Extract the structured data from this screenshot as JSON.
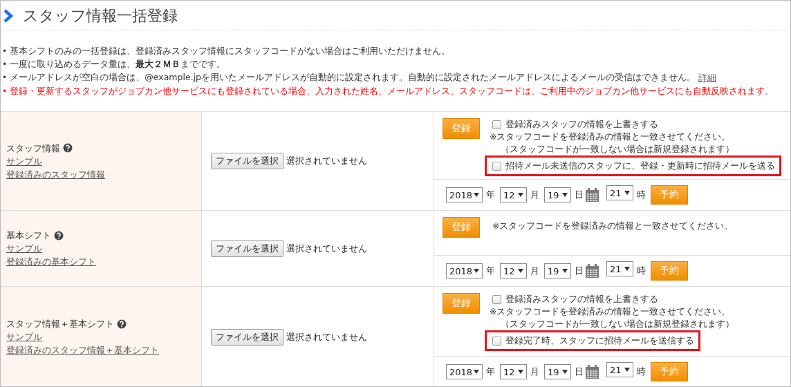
{
  "page": {
    "title": "スタッフ情報一括登録"
  },
  "notes": [
    {
      "kind": "plain",
      "text": "• 基本シフトのみの一括登録は、登録済みスタッフ情報にスタッフコードがない場合はご利用いただけません。"
    },
    {
      "kind": "plain",
      "text": "• 一度に取り込めるデータ量は、**最大２ＭＢ**までです。"
    },
    {
      "kind": "plain",
      "text": "• メールアドレスが空白の場合は、@example.jpを用いたメールアドレスが自動的に設定されます。自動的に設定されたメールアドレスによるメールの受信はできません。",
      "link": "詳細"
    },
    {
      "kind": "warning",
      "text": "• 登録・更新するスタッフがジョブカン他サービスにも登録されている場合、入力された姓名、メールアドレス、スタッフコードは、ご利用中のジョブカン他サービスにも自動反映されます。"
    }
  ],
  "sections": [
    {
      "label": "スタッフ情報",
      "help": true,
      "links": [
        "サンプル",
        "登録済みのスタッフ情報"
      ],
      "file_button": "ファイルを選択",
      "file_status": "選択されていません",
      "register_button": "登録",
      "options": [
        {
          "kind": "checkbox",
          "label": "登録済みスタッフの情報を上書きする",
          "checked": false,
          "highlighted": false
        },
        {
          "kind": "note",
          "text": "※スタッフコードを登録済みの情報と一致させてください。"
        },
        {
          "kind": "subnote",
          "text": "（スタッフコードが一致しない場合は新規登録されます）"
        },
        {
          "kind": "checkbox",
          "label": "招待メール未送信のスタッフに、登録・更新時に招待メールを送る",
          "checked": false,
          "highlighted": true
        }
      ],
      "schedule": {
        "year": "2018",
        "year_unit": "年",
        "month": "12",
        "month_unit": "月",
        "day": "19",
        "day_unit": "日",
        "hour": "21",
        "hour_unit": "時",
        "button": "予約"
      }
    },
    {
      "label": "基本シフト",
      "help": true,
      "links": [
        "サンプル",
        "登録済みの基本シフト"
      ],
      "file_button": "ファイルを選択",
      "file_status": "選択されていません",
      "register_button": "登録",
      "options": [
        {
          "kind": "inline-note",
          "text": "※スタッフコードを登録済みの情報と一致させてください。"
        }
      ],
      "schedule": {
        "year": "2018",
        "year_unit": "年",
        "month": "12",
        "month_unit": "月",
        "day": "19",
        "day_unit": "日",
        "hour": "21",
        "hour_unit": "時",
        "button": "予約"
      }
    },
    {
      "label": "スタッフ情報＋基本シフト",
      "help": true,
      "links": [
        "サンプル",
        "登録済みのスタッフ情報＋基本シフト"
      ],
      "file_button": "ファイルを選択",
      "file_status": "選択されていません",
      "register_button": "登録",
      "options": [
        {
          "kind": "checkbox",
          "label": "登録済みスタッフの情報を上書きする",
          "checked": false,
          "highlighted": false
        },
        {
          "kind": "note",
          "text": "※スタッフコードを登録済みの情報と一致させてください。"
        },
        {
          "kind": "subnote",
          "text": "（スタッフコードが一致しない場合は新規登録されます）"
        },
        {
          "kind": "checkbox",
          "label": "登録完了時、スタッフに招待メールを送信する",
          "checked": false,
          "highlighted": true
        }
      ],
      "schedule": {
        "year": "2018",
        "year_unit": "年",
        "month": "12",
        "month_unit": "月",
        "day": "19",
        "day_unit": "日",
        "hour": "21",
        "hour_unit": "時",
        "button": "予約"
      }
    }
  ]
}
